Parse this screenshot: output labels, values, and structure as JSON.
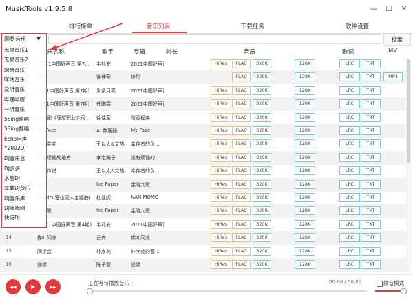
{
  "app": {
    "title": "MusicTools v1.9.5.8"
  },
  "window": {
    "minimize": "—",
    "maximize": "☐",
    "close": "✕"
  },
  "tabs": [
    {
      "label": "排行榜单"
    },
    {
      "label": "音乐列表"
    },
    {
      "label": "下载任务"
    },
    {
      "label": "软件设置"
    }
  ],
  "search": {
    "source": "网易音乐",
    "placeholder": "",
    "button": "搜索"
  },
  "columns": {
    "title": "音乐名称",
    "singer": "歌手",
    "album": "专辑",
    "duration": "时长",
    "quality": "音质",
    "lyrics": "歌词",
    "mv": "MV"
  },
  "source_menu": {
    "selected": "网易音乐",
    "items": [
      "无损音乐1",
      "无损音乐2",
      "网易音乐",
      "咪咕音乐",
      "爱听音乐",
      "哔哩哔哩",
      "一听音乐",
      "5Sing原唱",
      "5Sing翻唱",
      "Echo回声",
      "Y2002DJ",
      "DJ音乐盒",
      "DJ多多",
      "水晶DJ",
      "车载DJ音乐",
      "DJ音乐库",
      "DJ嗨嗨网",
      "快嗨DJ"
    ]
  },
  "rows": [
    {
      "num": "",
      "title": "(2021中国好声音 第7...",
      "singer": "韦礼安",
      "album": "2021中国好声音",
      "hires": "HiRes",
      "flac": "FLAC",
      "q320": "320K",
      "q128": "128K",
      "lrc": "LRC",
      "txt": "TXT",
      "mp4": ""
    },
    {
      "num": "",
      "title": "矬彤",
      "singer": "徐佳莹",
      "album": "矬彤",
      "hires": "",
      "flac": "FLAC",
      "q320": "320K",
      "q128": "128K",
      "lrc": "LRC",
      "txt": "TXT",
      "mp4": "MP4"
    },
    {
      "num": "",
      "title": "2021中国好声音 第7期)",
      "singer": "发条月亮",
      "album": "2021中国好声音",
      "hires": "HiRes",
      "flac": "FLAC",
      "q320": "320K",
      "q128": "128K",
      "lrc": "LRC",
      "txt": "TXT",
      "mp4": ""
    },
    {
      "num": "",
      "title": "2021中国好声音 第7期)",
      "singer": "任曦霖",
      "album": "2021中国好声音",
      "hires": "HiRes",
      "flac": "FLAC",
      "q320": "320K",
      "q128": "128K",
      "lrc": "LRC",
      "txt": "TXT",
      "mp4": ""
    },
    {
      "num": "",
      "title": "电视剧《理想职业公司...",
      "singer": "徐佳莹",
      "album": "附蜜程序",
      "hires": "HiRes",
      "flac": "FLAC",
      "q320": "320K",
      "q128": "128K",
      "lrc": "LRC",
      "txt": "TXT",
      "mp4": ""
    },
    {
      "num": "",
      "title": "My Face",
      "singer": "AI 数理器",
      "album": "My Face",
      "hires": "HiRes",
      "flac": "FLAC",
      "q320": "320K",
      "q128": "128K",
      "lrc": "LRC",
      "txt": "TXT",
      "mp4": ""
    },
    {
      "num": "",
      "title": "别怕变老",
      "singer": "王以太&艾热",
      "album": "幸存者的负...",
      "hires": "HiRes",
      "flac": "FLAC",
      "q320": "320K",
      "q128": "128K",
      "lrc": "LRC",
      "txt": "TXT",
      "mp4": ""
    },
    {
      "num": "",
      "title": "没有烦恼的地方",
      "singer": "李宏美子",
      "album": "没有烦恼的...",
      "hires": "HiRes",
      "flac": "FLAC",
      "q320": "320K",
      "q128": "128K",
      "lrc": "LRC",
      "txt": "TXT",
      "mp4": ""
    },
    {
      "num": "",
      "title": "乡野传说",
      "singer": "王以太&艾热",
      "album": "幸存者的负...",
      "hires": "HiRes",
      "flac": "FLAC",
      "q320": "320K",
      "q128": "128K",
      "lrc": "LRC",
      "txt": "TXT",
      "mp4": ""
    },
    {
      "num": "",
      "title": "云纹",
      "singer": "Ice Paper",
      "album": "金陵九歌",
      "hires": "HiRes",
      "flac": "FLAC",
      "q320": "320K",
      "q128": "128K",
      "lrc": "LRC",
      "txt": "TXT",
      "mp4": ""
    },
    {
      "num": "",
      "title": "MOMO(塞山泥人主题曲)",
      "singer": "杜佳妮",
      "album": "NANIMOMO",
      "hires": "HiRes",
      "flac": "FLAC",
      "q320": "320K",
      "q128": "128K",
      "lrc": "LRC",
      "txt": "TXT",
      "mp4": ""
    },
    {
      "num": "",
      "title": "正气歌",
      "singer": "Ice Paper",
      "album": "金陵九歌",
      "hires": "HiRes",
      "flac": "FLAC",
      "q320": "320K",
      "q128": "128K",
      "lrc": "LRC",
      "txt": "TXT",
      "mp4": ""
    },
    {
      "num": "13",
      "title": "(2021中国好声音 第4期)",
      "singer": "韦礼安",
      "album": "2021中国好声音",
      "hires": "HiRes",
      "flac": "FLAC",
      "q320": "320K",
      "q128": "128K",
      "lrc": "LRC",
      "txt": "TXT",
      "mp4": ""
    },
    {
      "num": "14",
      "title": "梯叶问凉",
      "singer": "云卉",
      "album": "梯叶问凉",
      "hires": "HiRes",
      "flac": "FLAC",
      "q320": "320K",
      "q128": "128K",
      "lrc": "LRC",
      "txt": "TXT",
      "mp4": ""
    },
    {
      "num": "15",
      "title": "同学会",
      "singer": "朴序苑",
      "album": "朴序苑的音...",
      "hires": "HiRes",
      "flac": "FLAC",
      "q320": "320K",
      "q128": "128K",
      "lrc": "LRC",
      "txt": "TXT",
      "mp4": ""
    },
    {
      "num": "16",
      "title": "遥嫖",
      "singer": "陈子健",
      "album": "遥嫖",
      "hires": "HiRes",
      "flac": "FLAC",
      "q320": "320K",
      "q128": "128K",
      "lrc": "LRC",
      "txt": "TXT",
      "mp4": ""
    }
  ],
  "player": {
    "prev_icon": "◀◀",
    "play_icon": "▶",
    "next_icon": "▶▶",
    "status": "正在等待播放音乐~",
    "time": "00:00 / 00:00",
    "mute_label": "静音模式"
  },
  "colors": {
    "accent": "#e23a3a",
    "hires": "#e8c07a",
    "flac": "#7ccfb8",
    "q320": "#7ccfb8",
    "q128": "#7fc7df",
    "lrc": "#7fc7df"
  }
}
